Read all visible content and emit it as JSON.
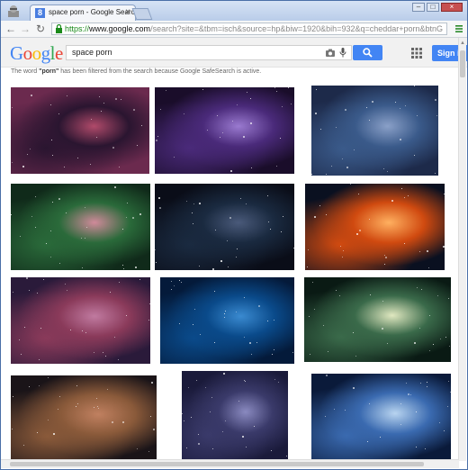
{
  "browser": {
    "tab_title": "space porn - Google Search",
    "tab_close": "×",
    "tab_favicon": "8",
    "url_scheme": "https://",
    "url_host": "www.google.com",
    "url_path": "/search?site=&tbm=isch&source=hp&biw=1920&bih=932&q=cheddar+porn&btnG",
    "back": "←",
    "forward": "→",
    "reload": "↻",
    "min": "–",
    "max": "□",
    "close": "×"
  },
  "google": {
    "logo_letters": [
      "G",
      "o",
      "o",
      "g",
      "l",
      "e"
    ],
    "logo_colors": [
      "#4285f4",
      "#ea4335",
      "#fbbc05",
      "#4285f4",
      "#34a853",
      "#ea4335"
    ],
    "search_query": "space porn",
    "signin_label": "Sign in",
    "notice_before": "The word ",
    "notice_bold": "\"porn\"",
    "notice_after": " has been filtered from the search because Google SafeSearch is active."
  },
  "images": [
    {
      "name": "nebula-pink-purple",
      "colors": [
        "#6b2a4e",
        "#2a1530",
        "#b04a6a"
      ]
    },
    {
      "name": "galaxy-purple-band",
      "colors": [
        "#1a0d2a",
        "#4a2a7a",
        "#9a7ad0"
      ]
    },
    {
      "name": "starfield-blue",
      "colors": [
        "#1d2a4a",
        "#3a5a8a",
        "#8aa0c8"
      ]
    },
    {
      "name": "nebula-green",
      "colors": [
        "#102a1a",
        "#2a6a3a",
        "#d08a9a"
      ]
    },
    {
      "name": "deep-space-dark",
      "colors": [
        "#0a0d18",
        "#1a2a40",
        "#4a5a7a"
      ]
    },
    {
      "name": "planet-sunrise",
      "colors": [
        "#0a1020",
        "#d04a10",
        "#ffb060"
      ]
    },
    {
      "name": "nebula-orion",
      "colors": [
        "#2a1a3a",
        "#8a3a5a",
        "#c07aa0"
      ]
    },
    {
      "name": "blue-nebula",
      "colors": [
        "#041a3a",
        "#0a4a8a",
        "#3a8ad0"
      ]
    },
    {
      "name": "planets-green-light",
      "colors": [
        "#0a1a14",
        "#3a6a4a",
        "#e0e8c0"
      ]
    },
    {
      "name": "astronaut-helmet",
      "colors": [
        "#1a1418",
        "#8a5a3a",
        "#c08060"
      ]
    },
    {
      "name": "starfield-purple",
      "colors": [
        "#1a1a3a",
        "#3a3a6a",
        "#8a8ac0"
      ]
    },
    {
      "name": "planet-horizon-blue",
      "colors": [
        "#0a1a3a",
        "#3a6ab0",
        "#b8d4f0"
      ]
    }
  ]
}
